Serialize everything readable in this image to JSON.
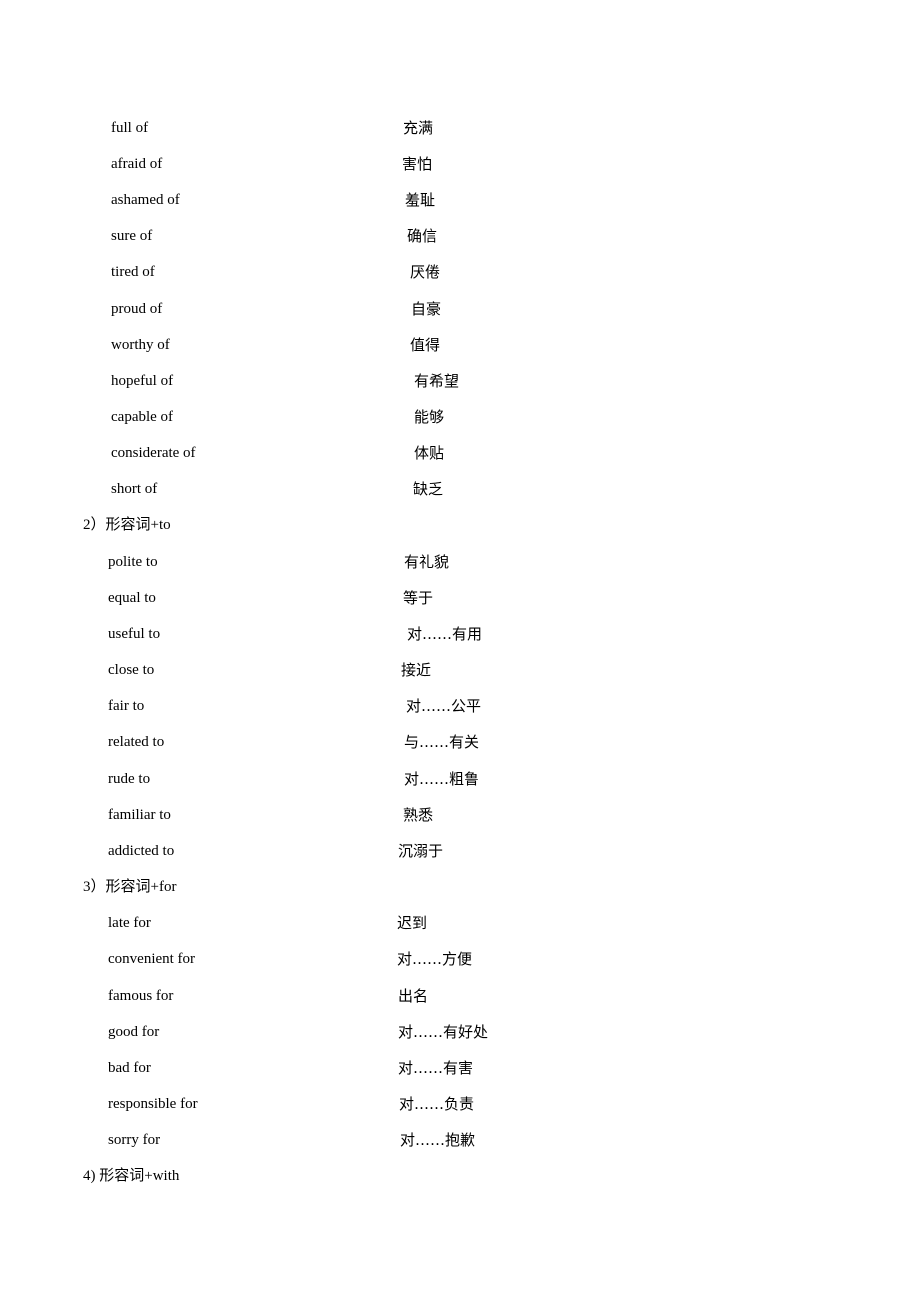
{
  "document": {
    "groups": [
      {
        "heading": "",
        "entries": [
          {
            "phrase": "full of",
            "meaning": "充满"
          },
          {
            "phrase": "afraid of",
            "meaning": "害怕"
          },
          {
            "phrase": "ashamed of",
            "meaning": "羞耻"
          },
          {
            "phrase": "sure of",
            "meaning": "确信"
          },
          {
            "phrase": "tired of",
            "meaning": "厌倦"
          },
          {
            "phrase": "proud of",
            "meaning": "自豪"
          },
          {
            "phrase": "worthy of",
            "meaning": "值得"
          },
          {
            "phrase": "hopeful of",
            "meaning": "有希望"
          },
          {
            "phrase": "capable of",
            "meaning": "能够"
          },
          {
            "phrase": "considerate of",
            "meaning": "体贴"
          },
          {
            "phrase": "short of",
            "meaning": "缺乏"
          }
        ]
      },
      {
        "heading": "2）形容词+to",
        "entries": [
          {
            "phrase": "polite to",
            "meaning": "有礼貌"
          },
          {
            "phrase": "equal to",
            "meaning": "等于"
          },
          {
            "phrase": "useful to",
            "meaning": "对……有用"
          },
          {
            "phrase": "close to",
            "meaning": "接近"
          },
          {
            "phrase": "fair to",
            "meaning": "对……公平"
          },
          {
            "phrase": "related to",
            "meaning": "与……有关"
          },
          {
            "phrase": "rude to",
            "meaning": "对……粗鲁"
          },
          {
            "phrase": "familiar to",
            "meaning": "熟悉"
          },
          {
            "phrase": "addicted to",
            "meaning": "沉溺于"
          }
        ]
      },
      {
        "heading": "3）形容词+for",
        "entries": [
          {
            "phrase": "late for",
            "meaning": "迟到"
          },
          {
            "phrase": "convenient for",
            "meaning": "对……方便"
          },
          {
            "phrase": "famous for",
            "meaning": "出名"
          },
          {
            "phrase": "good for",
            "meaning": "对……有好处"
          },
          {
            "phrase": "bad for",
            "meaning": "对……有害"
          },
          {
            "phrase": "responsible for",
            "meaning": "对……负责"
          },
          {
            "phrase": "sorry for",
            "meaning": "对……抱歉"
          }
        ]
      },
      {
        "heading": "4)  形容词+with",
        "entries": []
      }
    ]
  }
}
